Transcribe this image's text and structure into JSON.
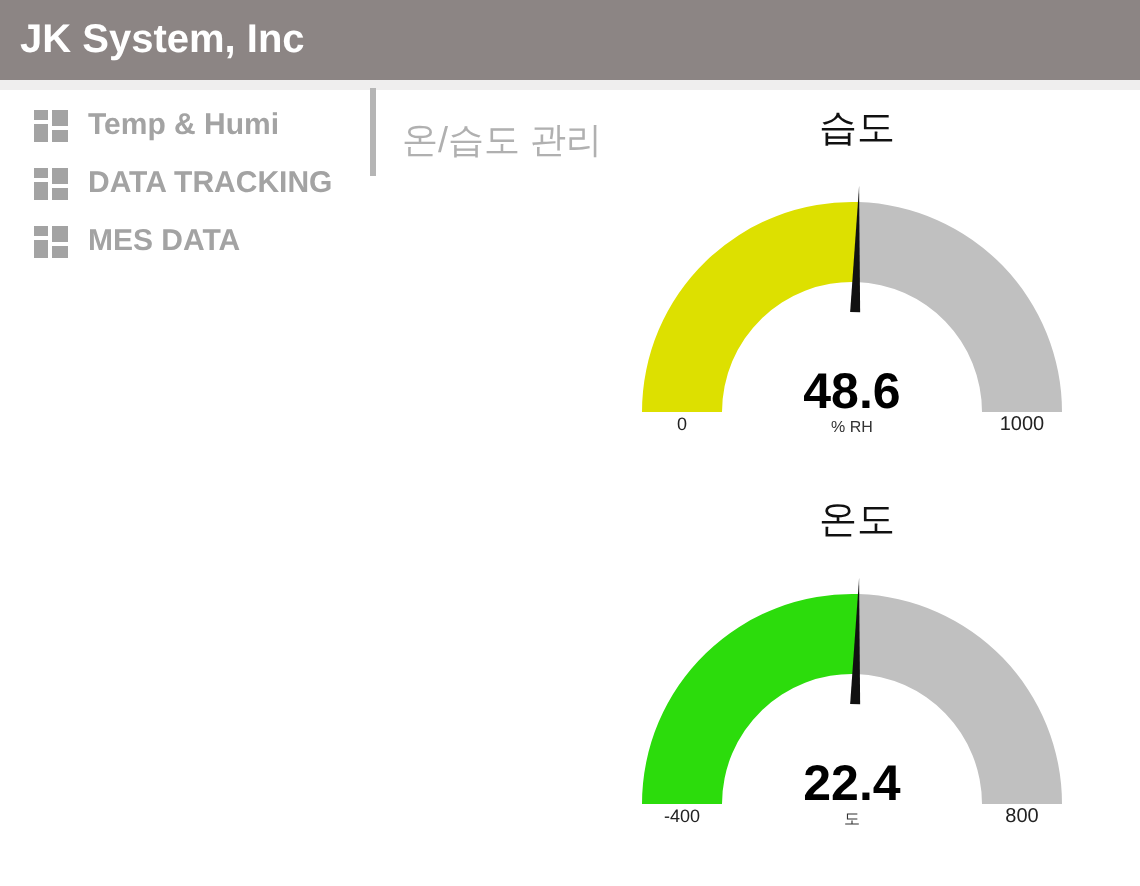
{
  "header": {
    "title": "JK System, Inc"
  },
  "sidebar": {
    "items": [
      {
        "label": "Temp & Humi"
      },
      {
        "label": "DATA TRACKING"
      },
      {
        "label": "MES DATA"
      }
    ]
  },
  "page": {
    "title": "온/습도 관리"
  },
  "gauges": [
    {
      "title": "습도",
      "value": "48.6",
      "unit": "% RH",
      "min": "0",
      "max": "1000",
      "color": "#dde000"
    },
    {
      "title": "온도",
      "value": "22.4",
      "unit": "도",
      "min": "-400",
      "max": "800",
      "color": "#2cdc0c"
    }
  ]
}
